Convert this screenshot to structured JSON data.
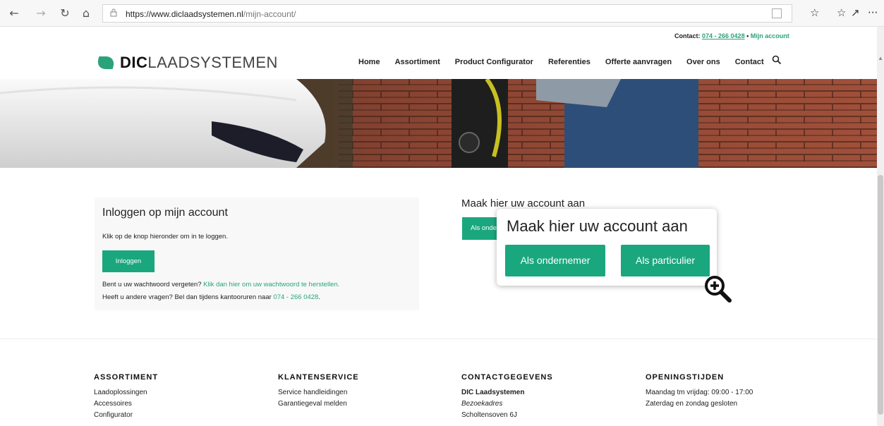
{
  "browser": {
    "url_host": "https://www.diclaadsystemen.nl",
    "url_path": "/mijn-account/",
    "back": "←",
    "forward": "→",
    "refresh": "↻",
    "home": "⌂",
    "lock": "🔒",
    "favorite": "☆",
    "favorites_bar": "☆",
    "share": "↗",
    "more": "···"
  },
  "topbar": {
    "contact_label": "Contact:",
    "phone": "074 - 266 0428",
    "separator": " • ",
    "account": "Mijn account"
  },
  "header": {
    "logo_bold": "DIC",
    "logo_thin": "LAADSYSTEMEN",
    "menu": [
      "Home",
      "Assortiment",
      "Product Configurator",
      "Referenties",
      "Offerte aanvragen",
      "Over ons",
      "Contact"
    ]
  },
  "login": {
    "title": "Inloggen op mijn account",
    "text": "Klik op de knop hieronder om in te loggen.",
    "button": "Inloggen",
    "forgot_prefix": "Bent u uw wachtwoord vergeten? ",
    "forgot_link": "Klik dan hier om uw wachtwoord te herstellen.",
    "questions_prefix": "Heeft u andere vragen? Bel dan tijdens kantooruren naar ",
    "questions_phone": "074 - 266 0428",
    "questions_suffix": "."
  },
  "register": {
    "title": "Maak hier uw account aan",
    "small_button": "Als ondernemer"
  },
  "popup": {
    "title": "Maak hier uw account aan",
    "business_button": "Als ondernemer",
    "private_button": "Als particulier"
  },
  "footer": {
    "assortiment": {
      "heading": "ASSORTIMENT",
      "items": [
        "Laadoplossingen",
        "Accessoires",
        "Configurator"
      ]
    },
    "klantenservice": {
      "heading": "KLANTENSERVICE",
      "items": [
        "Service handleidingen",
        "Garantiegeval melden"
      ]
    },
    "contact": {
      "heading": "CONTACTGEGEVENS",
      "company": "DIC Laadsystemen",
      "address_label": "Bezoekadres",
      "street": "Scholtensoven 6J"
    },
    "hours": {
      "heading": "OPENINGSTIJDEN",
      "items": [
        "Maandag tm vrijdag: 09:00 - 17:00",
        "Zaterdag en zondag gesloten"
      ]
    }
  },
  "colors": {
    "brand_green": "#1ba77e",
    "link_green": "#2aa37c"
  }
}
